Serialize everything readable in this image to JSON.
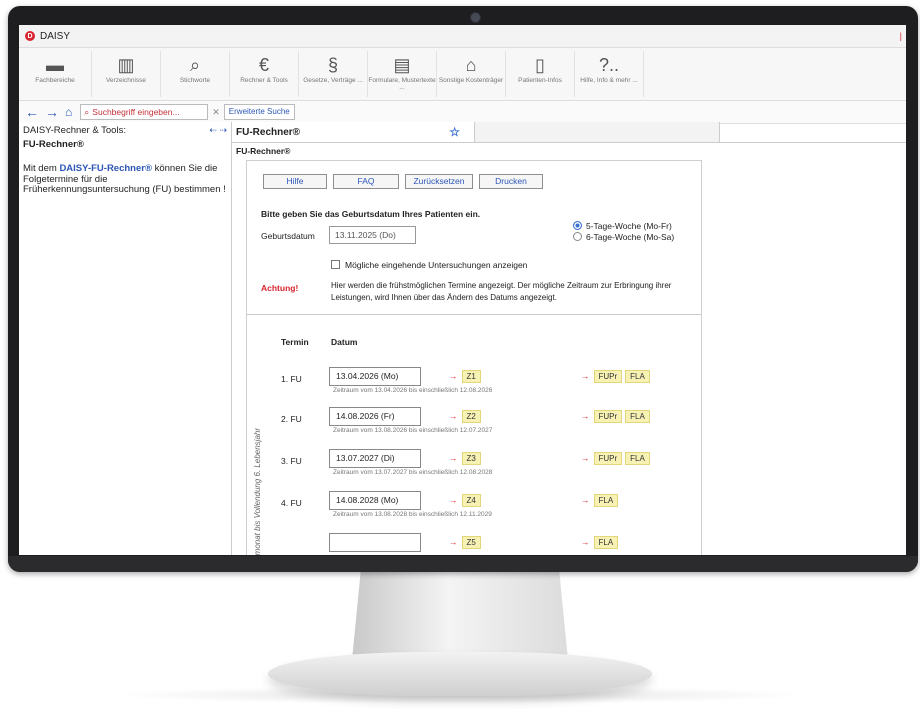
{
  "app": {
    "title": "DAISY",
    "logo_letter": "D"
  },
  "toolbar": {
    "items": [
      {
        "icon": "folder-icon",
        "glyph": "▬",
        "label": "Fachbereiche"
      },
      {
        "icon": "books-icon",
        "glyph": "▥",
        "label": "Verzeichnisse"
      },
      {
        "icon": "magnifier-icon",
        "glyph": "⌕",
        "label": "Stichworte"
      },
      {
        "icon": "euro-icon",
        "glyph": "€",
        "label": "Rechner & Tools"
      },
      {
        "icon": "paragraph-icon",
        "glyph": "§",
        "label": "Gesetze, Verträge ..."
      },
      {
        "icon": "document-icon",
        "glyph": "▤",
        "label": "Formulare, Mustertexte ..."
      },
      {
        "icon": "bank-icon",
        "glyph": "⌂",
        "label": "Sonstige Kostenträger"
      },
      {
        "icon": "tablet-icon",
        "glyph": "▯",
        "label": "Patienten-Infos"
      },
      {
        "icon": "help-icon",
        "glyph": "?..",
        "label": "Hilfe, Info & mehr ..."
      }
    ]
  },
  "nav": {
    "search_placeholder": "Suchbegriff eingeben...",
    "extended_search": "Erweiterte Suche"
  },
  "left": {
    "header": "DAISY-Rechner & Tools:",
    "title": "FU-Rechner®",
    "text_before": "Mit dem ",
    "highlight": "DAISY-FU-Rechner®",
    "text_after": " können Sie die Folgetermine für die Früherkennungsuntersuchung (FU) bestimmen !"
  },
  "tab": {
    "label": "FU-Rechner®"
  },
  "form": {
    "legend": "FU-Rechner®",
    "buttons": [
      "Hilfe",
      "FAQ",
      "Zurücksetzen",
      "Drucken"
    ],
    "intro": "Bitte geben Sie das Geburtsdatum Ihres Patienten ein.",
    "birth_label": "Geburtsdatum",
    "birth_value": "13.11.2025 (Do)",
    "radio1": "5-Tage-Woche (Mo-Fr)",
    "radio2": "6-Tage-Woche (Mo-Sa)",
    "radio_selected": "5-Tage-Woche (Mo-Fr)",
    "checkbox_label": "Mögliche eingehende Untersuchungen anzeigen",
    "warn_label": "Achtung!",
    "warn_text": "Hier werden die frühstmöglichen Termine angezeigt. Der mögliche Zeitraum zur Erbringung ihrer Leistungen, wird Ihnen über das Ändern des Datums angezeigt.",
    "col_termin": "Termin",
    "col_datum": "Datum",
    "vertical_label": "...smonat bis Vollendung 6. Lebensjahr"
  },
  "fu_rows": [
    {
      "label": "1. FU",
      "date": "13.04.2026 (Mo)",
      "range": "Zeitraum vom 13.04.2026 bis einschließlich 12.08.2026",
      "z": "Z1",
      "tags": [
        "FUPr",
        "FLA"
      ]
    },
    {
      "label": "2. FU",
      "date": "14.08.2026 (Fr)",
      "range": "Zeitraum vom 13.08.2026 bis einschließlich 12.07.2027",
      "z": "Z2",
      "tags": [
        "FUPr",
        "FLA"
      ]
    },
    {
      "label": "3. FU",
      "date": "13.07.2027 (Di)",
      "range": "Zeitraum vom 13.07.2027 bis einschließlich 12.08.2028",
      "z": "Z3",
      "tags": [
        "FUPr",
        "FLA"
      ]
    },
    {
      "label": "4. FU",
      "date": "14.08.2028 (Mo)",
      "range": "Zeitraum vom 13.08.2028 bis einschließlich 12.11.2029",
      "z": "Z4",
      "tags": [
        "FLA"
      ]
    },
    {
      "label": "",
      "date": "",
      "range": "",
      "z": "Z5",
      "tags": [
        "FLA"
      ]
    }
  ]
}
